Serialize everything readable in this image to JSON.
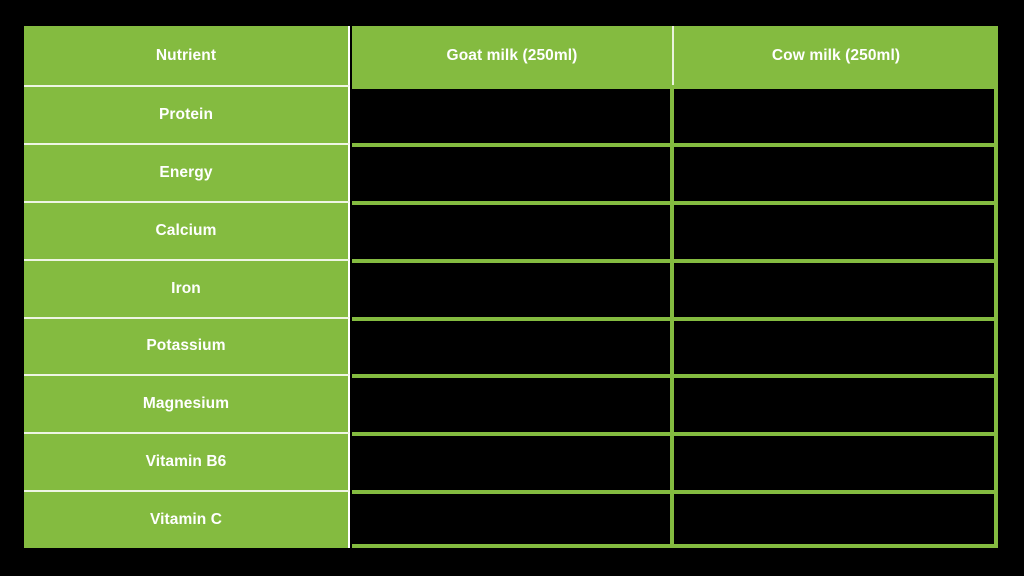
{
  "table": {
    "headers": [
      {
        "label": "Nutrient",
        "key": "nutrient"
      },
      {
        "label": "Goat milk (250ml)",
        "key": "goat"
      },
      {
        "label": "Cow milk (250ml)",
        "key": "cow"
      }
    ],
    "rows": [
      {
        "nutrient": "Protein",
        "goat": "",
        "cow": ""
      },
      {
        "nutrient": "Energy",
        "goat": "",
        "cow": ""
      },
      {
        "nutrient": "Calcium",
        "goat": "",
        "cow": ""
      },
      {
        "nutrient": "Iron",
        "goat": "",
        "cow": ""
      },
      {
        "nutrient": "Potassium",
        "goat": "",
        "cow": ""
      },
      {
        "nutrient": "Magnesium",
        "goat": "",
        "cow": ""
      },
      {
        "nutrient": "Vitamin B6",
        "goat": "",
        "cow": ""
      },
      {
        "nutrient": "Vitamin  C",
        "goat": "",
        "cow": ""
      }
    ]
  },
  "colors": {
    "green": "#84bb40",
    "background": "#000000",
    "header_text": "#ffffff",
    "divider": "#eef5e3"
  }
}
